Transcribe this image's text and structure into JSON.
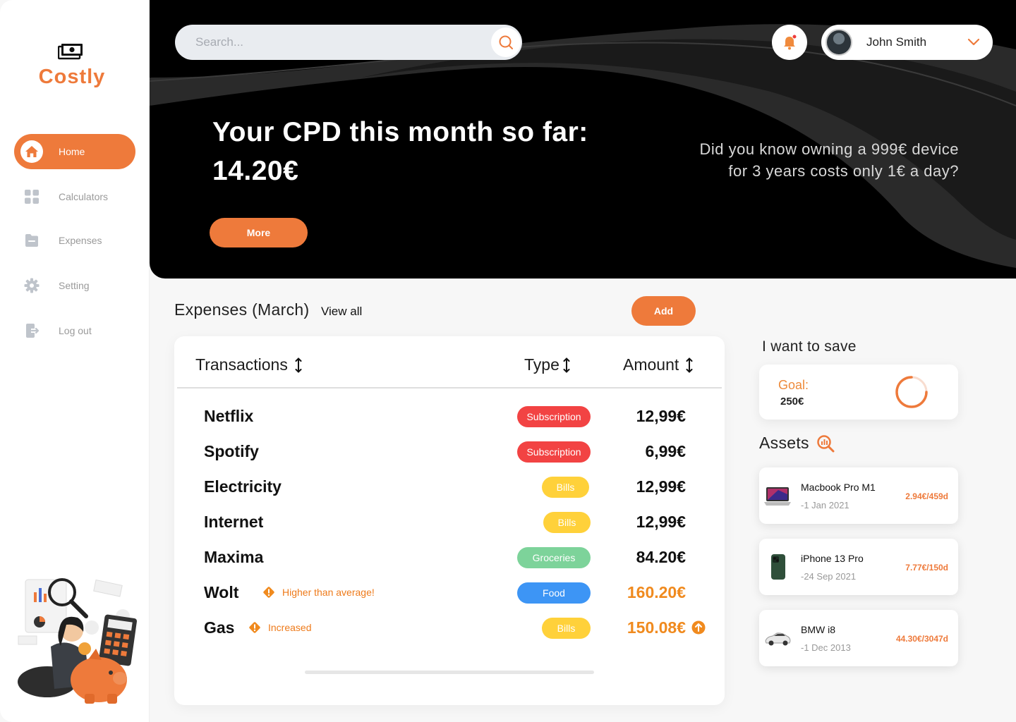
{
  "app": {
    "name": "Costly"
  },
  "sidebar": {
    "items": [
      {
        "label": "Home",
        "icon": "home-icon",
        "active": true
      },
      {
        "label": "Calculators",
        "icon": "grid-icon"
      },
      {
        "label": "Expenses",
        "icon": "folder-icon"
      },
      {
        "label": "Setting",
        "icon": "gear-icon"
      },
      {
        "label": "Log out",
        "icon": "logout-icon"
      }
    ]
  },
  "header": {
    "search_placeholder": "Search...",
    "user_name": "John Smith"
  },
  "hero": {
    "title_line1": "Your CPD this month so far:",
    "title_line2": "14.20€",
    "fact_line1": "Did you know owning a 999€ device",
    "fact_line2": "for 3 years costs only 1€ a day?",
    "more_label": "More"
  },
  "expenses": {
    "title": "Expenses (March)",
    "view_all": "View all",
    "add_label": "Add",
    "columns": [
      "Transactions",
      "Type",
      "Amount"
    ],
    "rows": [
      {
        "name": "Netflix",
        "type": "Subscription",
        "amount": "12,99€"
      },
      {
        "name": "Spotify",
        "type": "Subscription",
        "amount": "6,99€"
      },
      {
        "name": "Electricity",
        "type": "Bills",
        "amount": "12,99€"
      },
      {
        "name": "Internet",
        "type": "Bills",
        "amount": "12,99€"
      },
      {
        "name": "Maxima",
        "type": "Groceries",
        "amount": "84.20€"
      },
      {
        "name": "Wolt",
        "type": "Food",
        "amount": "160.20€",
        "warning": "Higher than average!"
      },
      {
        "name": "Gas",
        "type": "Bills",
        "amount": "150.08€",
        "warning": "Increased"
      }
    ]
  },
  "save": {
    "title": "I want to save",
    "goal_label": "Goal:",
    "goal_value": "250€"
  },
  "assets": {
    "title": "Assets",
    "items": [
      {
        "name": "Macbook Pro M1",
        "date": "-1 Jan 2021",
        "cost": "2.94€/459d"
      },
      {
        "name": "iPhone 13 Pro",
        "date": "-24 Sep 2021",
        "cost": "7.77€/150d"
      },
      {
        "name": "BMW i8",
        "date": "-1 Dec 2013",
        "cost": "44.30€/3047d"
      }
    ]
  },
  "colors": {
    "accent": "#ee7a3b",
    "subscription": "#f24343",
    "bills": "#ffd13a",
    "groceries": "#7dd39a",
    "food": "#3d95f5",
    "warning": "#f08a1e"
  }
}
